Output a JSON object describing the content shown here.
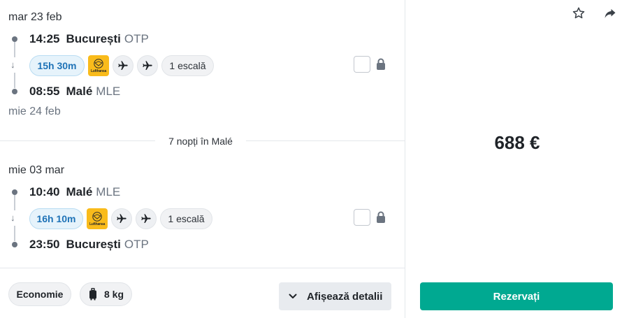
{
  "outbound": {
    "date_depart": "mar 23 feb",
    "depart_time": "14:25",
    "depart_city": "București",
    "depart_code": "OTP",
    "duration": "15h 30m",
    "stops": "1 escală",
    "arrive_time": "08:55",
    "arrive_city": "Malé",
    "arrive_code": "MLE",
    "date_arrive": "mie 24 feb"
  },
  "stay": {
    "nights_label": "7 nopți în Malé"
  },
  "inbound": {
    "date_depart": "mie 03 mar",
    "depart_time": "10:40",
    "depart_city": "Malé",
    "depart_code": "MLE",
    "duration": "16h 10m",
    "stops": "1 escală",
    "arrive_time": "23:50",
    "arrive_city": "București",
    "arrive_code": "OTP"
  },
  "airline": {
    "logo_text": "Lufthansa",
    "color": "#f9bb1b"
  },
  "footer": {
    "cabin_class": "Economie",
    "baggage": "8 kg",
    "details_button": "Afișează detalii"
  },
  "price_panel": {
    "price": "688 €",
    "book_button": "Rezervați",
    "book_color": "#00a991"
  },
  "icons": [
    "star-icon",
    "share-icon",
    "lock-icon",
    "plane-icon",
    "suitcase-icon",
    "chevron-down-icon",
    "arrow-down-icon"
  ]
}
